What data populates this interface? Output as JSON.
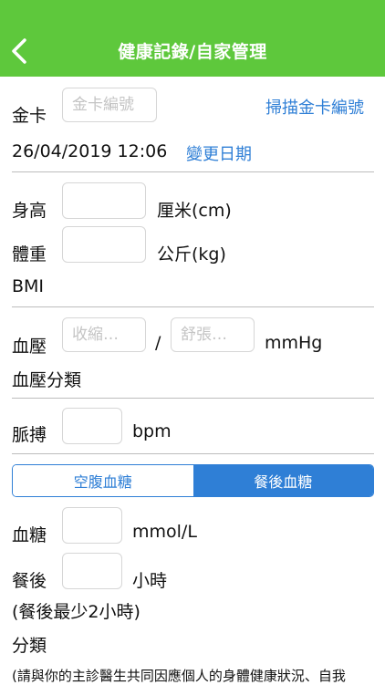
{
  "header": {
    "title": "健康記錄/自家管理"
  },
  "card": {
    "label": "金卡",
    "placeholder": "金卡編號",
    "scan_link": "掃描金卡編號"
  },
  "date": {
    "value": "26/04/2019 12:06",
    "change_link": "變更日期"
  },
  "height": {
    "label": "身高",
    "unit": "厘米(cm)"
  },
  "weight": {
    "label": "體重",
    "unit": "公斤(kg)"
  },
  "bmi": {
    "label": "BMI"
  },
  "bp": {
    "label": "血壓",
    "systolic_placeholder": "收縮…",
    "separator": "/",
    "diastolic_placeholder": "舒張…",
    "unit": "mmHg",
    "category_label": "血壓分類"
  },
  "pulse": {
    "label": "脈搏",
    "unit": "bpm"
  },
  "glucose_tabs": {
    "fasting": "空腹血糖",
    "after_meal": "餐後血糖",
    "selected": "after_meal"
  },
  "glucose": {
    "label": "血糖",
    "unit": "mmol/L"
  },
  "after_meal": {
    "label": "餐後",
    "unit": "小時",
    "hint": "(餐後最少2小時)"
  },
  "category": {
    "label": "分類"
  },
  "footer_note": "(請與你的主診醫生共同因應個人的身體健康狀況、自我"
}
